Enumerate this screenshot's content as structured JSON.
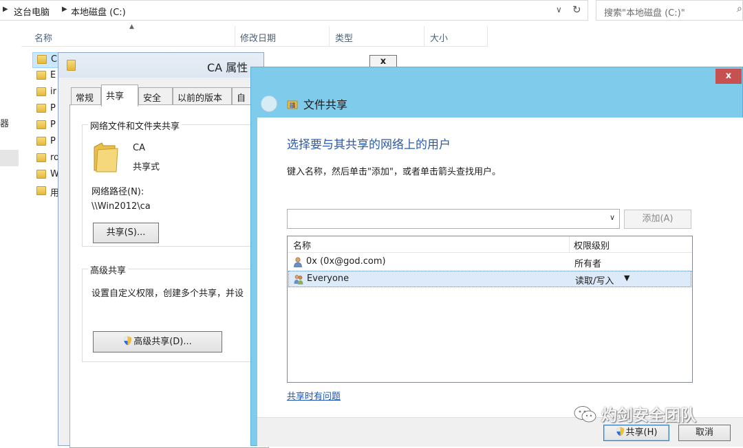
{
  "explorer": {
    "breadcrumb": [
      "这台电脑",
      "本地磁盘 (C:)"
    ],
    "search_placeholder": "搜索\"本地磁盘 (C:)\"",
    "columns": [
      "名称",
      "修改日期",
      "类型",
      "大小"
    ],
    "left_glyph": "器",
    "files": [
      "C",
      "E",
      "ir",
      "P",
      "P",
      "P",
      "ro",
      "W",
      "用"
    ]
  },
  "properties": {
    "title": "CA 属性",
    "close_label": "x",
    "tabs": [
      "常规",
      "共享",
      "安全",
      "以前的版本",
      "自"
    ],
    "group_network": {
      "title": "网络文件和文件夹共享",
      "folder_name": "CA",
      "folder_status": "共享式",
      "path_label": "网络路径(N):",
      "path_value": "\\\\Win2012\\ca",
      "share_button": "共享(S)..."
    },
    "group_advanced": {
      "title": "高级共享",
      "description": "设置自定义权限，创建多个共享，并设",
      "advanced_button": "高级共享(D)..."
    }
  },
  "wizard": {
    "title": "文件共享",
    "close_label": "x",
    "heading": "选择要与其共享的网络上的用户",
    "instruction": "键入名称，然后单击\"添加\"，或者单击箭头查找用户。",
    "combo_value": "",
    "add_button": "添加(A)",
    "columns": {
      "name": "名称",
      "permission": "权限级别"
    },
    "rows": [
      {
        "name": "0x (0x@god.com)",
        "permission": "所有者",
        "icon": "user-icon"
      },
      {
        "name": "Everyone",
        "permission": "读取/写入",
        "icon": "group-icon",
        "selected": true
      }
    ],
    "help_link": "共享时有问题",
    "share_button": "共享(H)",
    "cancel_button": "取消"
  },
  "watermark": {
    "text": "灼剑安全团队"
  }
}
